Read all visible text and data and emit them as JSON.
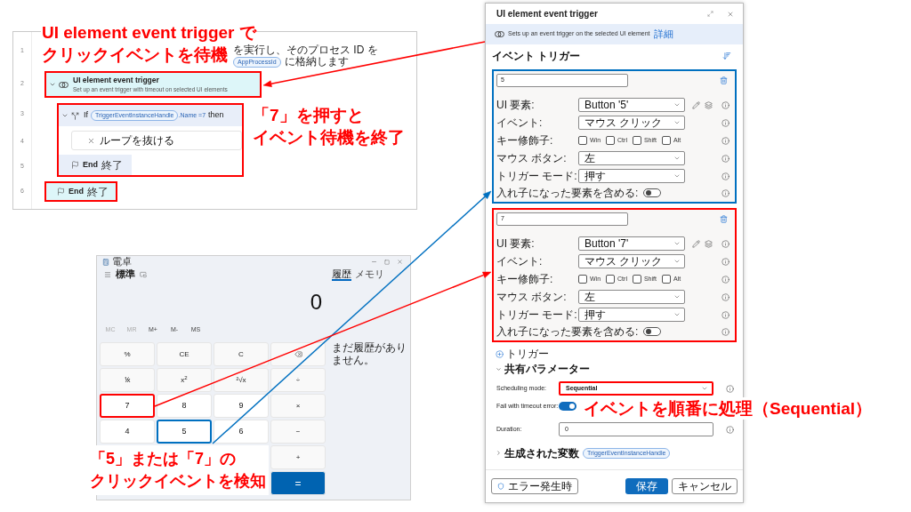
{
  "flow_panel": {
    "steps": [
      {
        "line": "1",
        "kind": "action",
        "text_before": "を実行し、そのプロセス ID を",
        "variable": "AppProcessId",
        "text_after": "に格納します"
      },
      {
        "line": "2",
        "kind": "trigger",
        "title": "UI element event trigger",
        "subtitle": "Set up an event trigger with timeout on selected UI elements",
        "expanded": true,
        "color": "#ff0000",
        "children": [
          {
            "kind": "group",
            "color": "#ff0000",
            "children": [
              {
                "line": "3",
                "kind": "if",
                "keyword": "If",
                "variable": "TriggerEventInstanceHandle",
                "condition": ".Name =7",
                "then": "then",
                "expanded": true,
                "children": [
                  {
                    "line": "4",
                    "kind": "exit_loop",
                    "label": "ループを抜ける"
                  }
                ]
              },
              {
                "line": "5",
                "kind": "if_end",
                "keyword": "End",
                "label": "終了"
              }
            ]
          }
        ]
      },
      {
        "line": "6",
        "kind": "trigger_end",
        "keyword": "End",
        "label": "終了",
        "color": "#ff0000"
      }
    ]
  },
  "calculator": {
    "title": "電卓",
    "mode": "標準",
    "display": "0",
    "history_tabs": [
      {
        "label": "履歴",
        "selected": true
      },
      {
        "label": "メモリ",
        "selected": false
      }
    ],
    "history_empty": "まだ履歴がありません。",
    "memory_buttons": [
      {
        "label": "MC",
        "disabled": true
      },
      {
        "label": "MR",
        "disabled": true
      },
      {
        "label": "M+",
        "disabled": false
      },
      {
        "label": "M-",
        "disabled": false
      },
      {
        "label": "MS",
        "disabled": false
      }
    ],
    "key_rows": [
      [
        {
          "kind": "function",
          "label": "%"
        },
        {
          "kind": "function",
          "label": "CE"
        },
        {
          "kind": "function",
          "label": "C"
        },
        {
          "kind": "backspace"
        }
      ],
      [
        {
          "kind": "function",
          "label": "⅟x"
        },
        {
          "kind": "function",
          "label": "x$^{2}$"
        },
        {
          "kind": "function",
          "label": "²√x"
        },
        {
          "kind": "function",
          "label": "÷"
        }
      ],
      [
        {
          "kind": "digit",
          "label": "7",
          "color": "#ff0000"
        },
        {
          "kind": "digit",
          "label": "8"
        },
        {
          "kind": "digit",
          "label": "9"
        },
        {
          "kind": "function",
          "label": "×"
        }
      ],
      [
        {
          "kind": "digit",
          "label": "4"
        },
        {
          "kind": "digit",
          "label": "5",
          "color": "#0070c0"
        },
        {
          "kind": "digit",
          "label": "6"
        },
        {
          "kind": "function",
          "label": "−"
        }
      ],
      [
        {
          "kind": "function",
          "label": "+"
        }
      ],
      [
        {
          "kind": "equals",
          "label": "="
        }
      ]
    ]
  },
  "dialog": {
    "title": "UI element event trigger",
    "info": "Sets up an event trigger on the selected UI element",
    "info_link": "詳細",
    "section_title": "イベント トリガー",
    "triggers": [
      {
        "name": "5",
        "color": "#0070c0",
        "fields": [
          {
            "kind": "element_select",
            "label": "UI 要素:",
            "value": "Button '5'",
            "info": true
          },
          {
            "kind": "select",
            "label": "イベント:",
            "value": "マウス クリック",
            "info": true
          },
          {
            "kind": "checkboxes",
            "label": "キー修飾子:",
            "options": [
              {
                "label": "Win",
                "checked": false
              },
              {
                "label": "Ctrl",
                "checked": false
              },
              {
                "label": "Shift",
                "checked": false
              },
              {
                "label": "Alt",
                "checked": false
              }
            ],
            "info": true
          },
          {
            "kind": "select",
            "label": "マウス ボタン:",
            "value": "左",
            "info": true
          },
          {
            "kind": "select",
            "label": "トリガー モード:",
            "value": "押す",
            "info": true
          },
          {
            "kind": "toggle",
            "label": "入れ子になった要素を含める:",
            "on": false,
            "info": true
          }
        ]
      },
      {
        "name": "7",
        "color": "#ff0000",
        "fields": [
          {
            "kind": "element_select",
            "label": "UI 要素:",
            "value": "Button '7'",
            "info": true
          },
          {
            "kind": "select",
            "label": "イベント:",
            "value": "マウス クリック",
            "info": true
          },
          {
            "kind": "checkboxes",
            "label": "キー修飾子:",
            "options": [
              {
                "label": "Win",
                "checked": false
              },
              {
                "label": "Ctrl",
                "checked": false
              },
              {
                "label": "Shift",
                "checked": false
              },
              {
                "label": "Alt",
                "checked": false
              }
            ],
            "info": true
          },
          {
            "kind": "select",
            "label": "マウス ボタン:",
            "value": "左",
            "info": true
          },
          {
            "kind": "select",
            "label": "トリガー モード:",
            "value": "押す",
            "info": true
          },
          {
            "kind": "toggle",
            "label": "入れ子になった要素を含める:",
            "on": false,
            "info": true
          }
        ]
      }
    ],
    "add_trigger": "トリガー",
    "shared": {
      "title": "共有パラメーター",
      "expanded": true,
      "fields": [
        {
          "kind": "select",
          "label": "Scheduling mode:",
          "value": "Sequential",
          "info": true,
          "color": "#ff0000"
        },
        {
          "kind": "toggle",
          "label": "Fail with timeout error:",
          "on": true,
          "info": false
        },
        {
          "kind": "input",
          "label": "Duration:",
          "value": "0",
          "info": true
        }
      ]
    },
    "variables": {
      "title": "生成された変数",
      "expanded": false,
      "items": [
        "TriggerEventInstanceHandle"
      ]
    },
    "footer": {
      "error_button": "エラー発生時",
      "save": "保存",
      "cancel": "キャンセル"
    }
  },
  "callouts": [
    {
      "lines": [
        "UI element event trigger で",
        "クリックイベントを待機"
      ]
    },
    {
      "lines": [
        "「7」を押すと",
        "イベント待機を終了"
      ]
    },
    {
      "lines": [
        "「5」または「7」の",
        "クリックイベントを検知"
      ]
    },
    {
      "lines": [
        "イベントを順番に処理（Sequential）"
      ]
    }
  ]
}
